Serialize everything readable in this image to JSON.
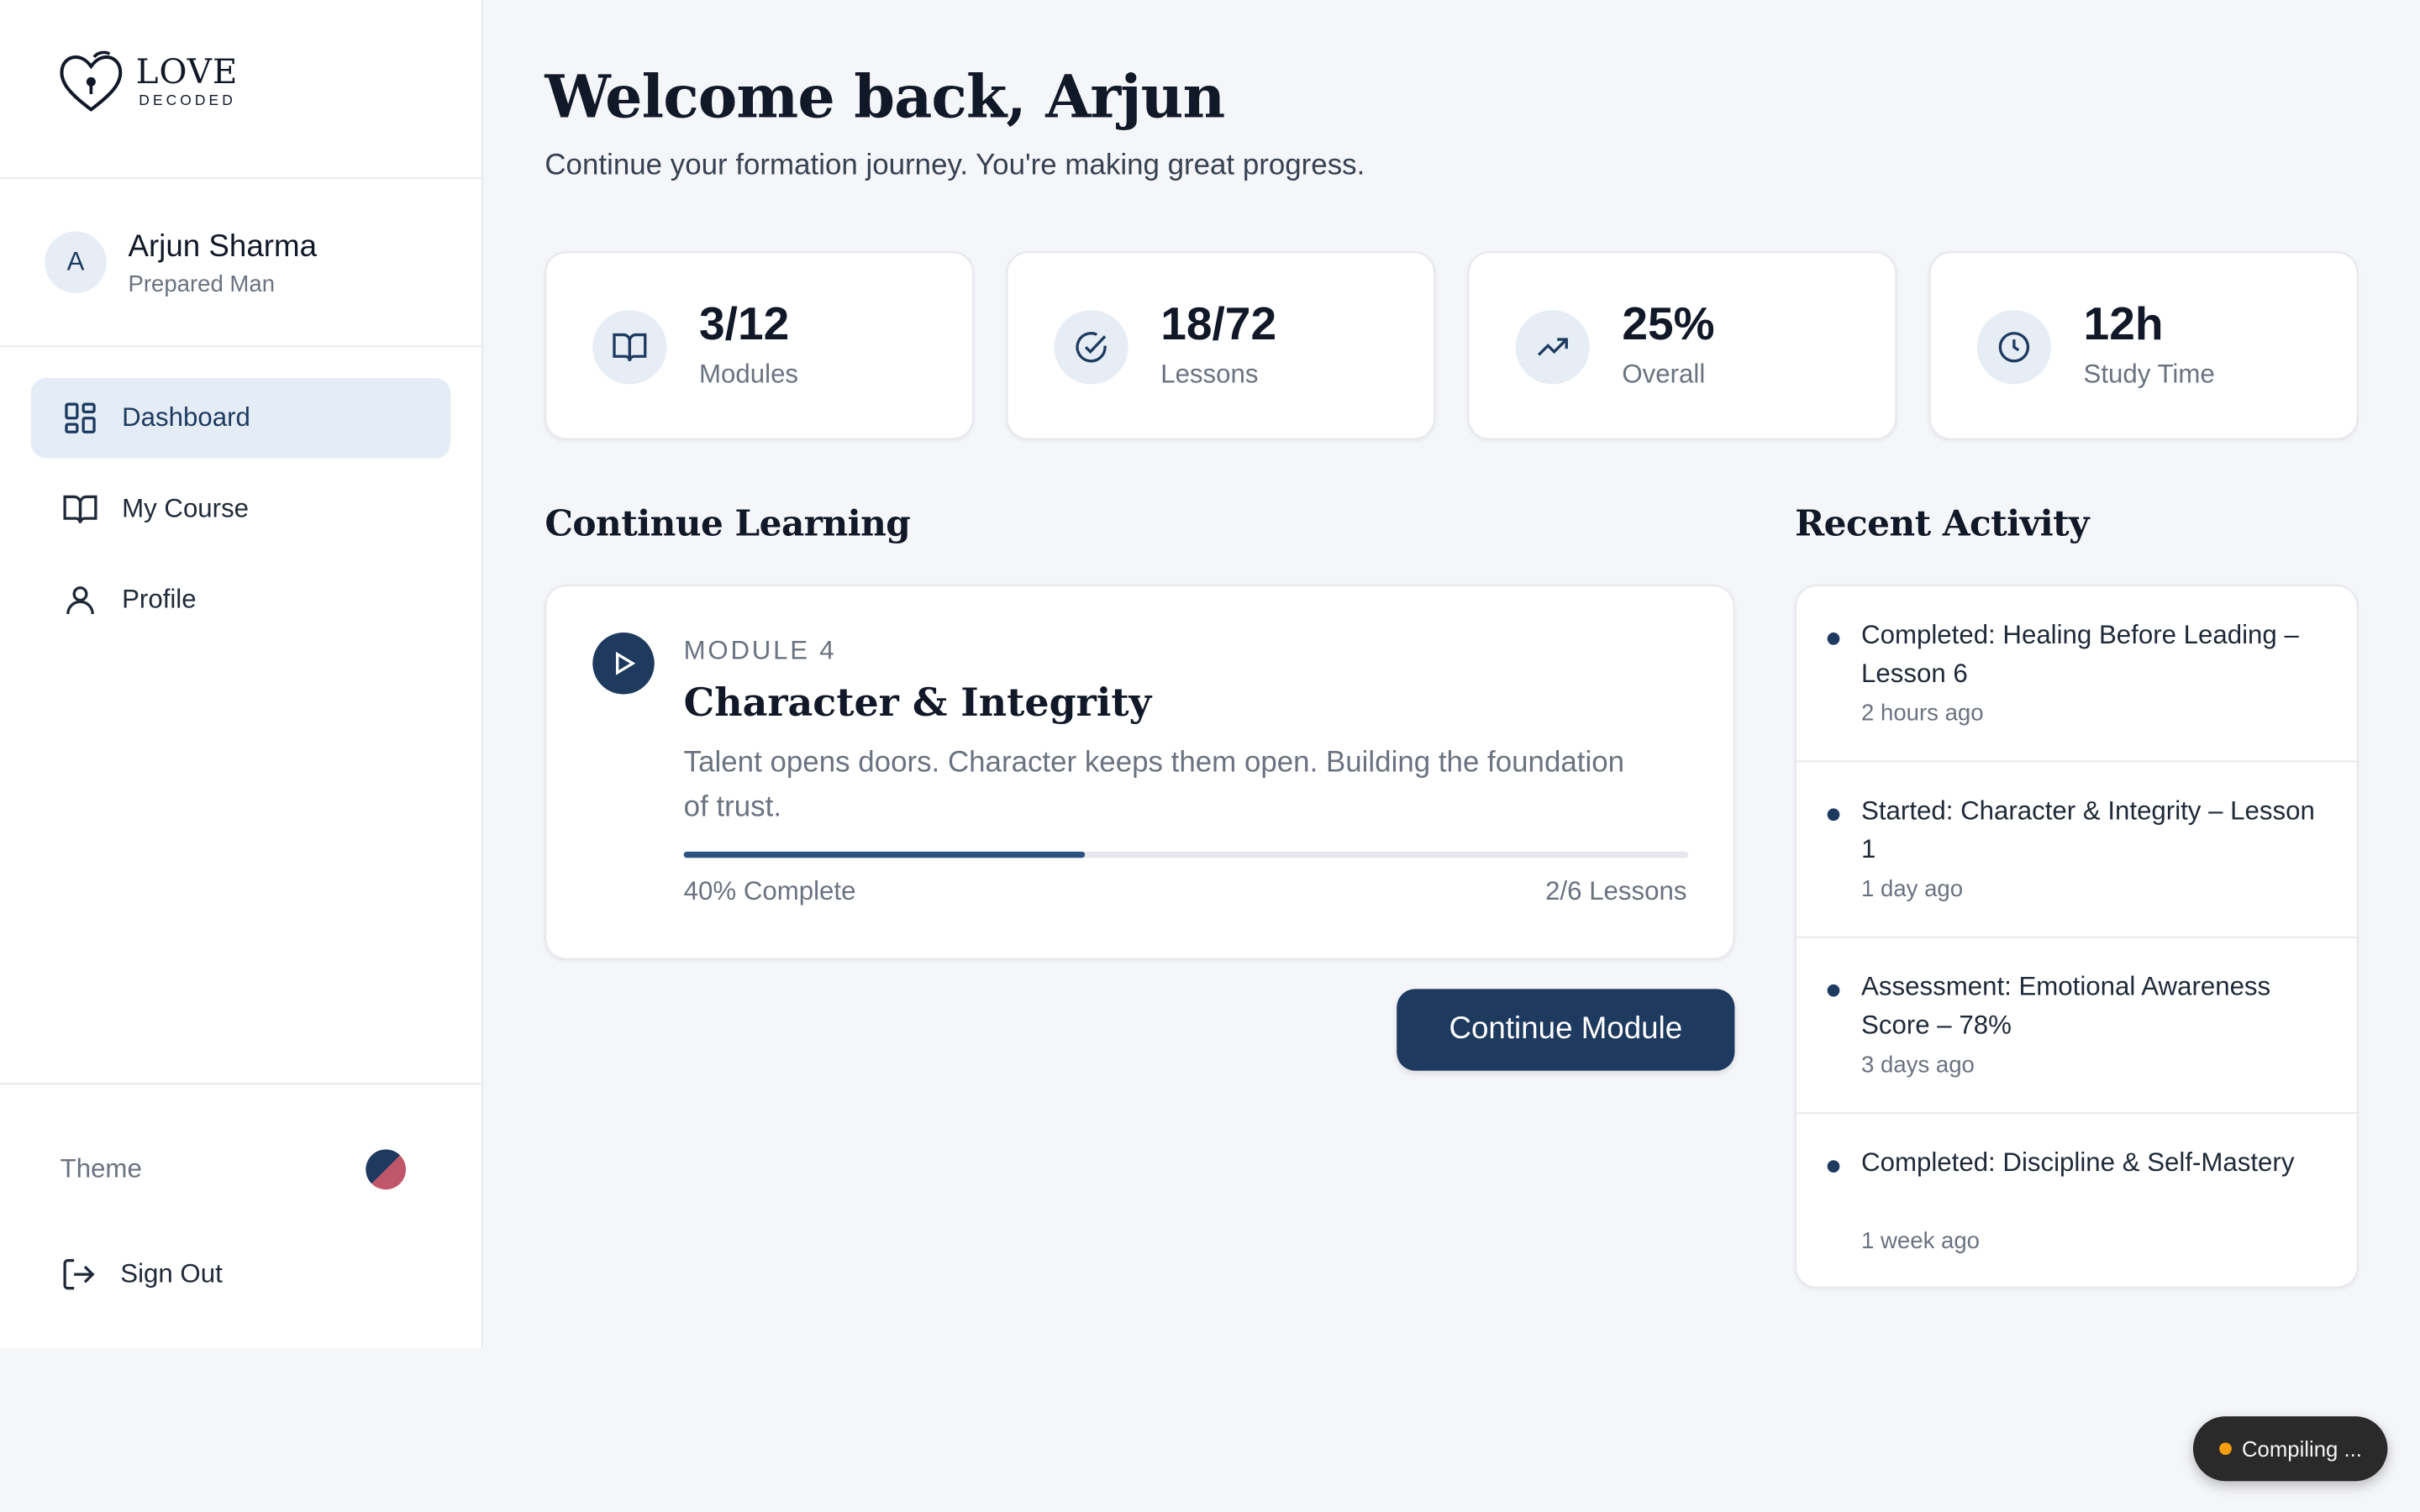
{
  "brand": {
    "word": "LOVE",
    "sub": "DECODED"
  },
  "user": {
    "initial": "A",
    "name": "Arjun Sharma",
    "role": "Prepared Man"
  },
  "nav": [
    {
      "label": "Dashboard",
      "icon": "dashboard-icon",
      "active": true
    },
    {
      "label": "My Course",
      "icon": "book-icon",
      "active": false
    },
    {
      "label": "Profile",
      "icon": "user-icon",
      "active": false
    }
  ],
  "sidebar_bottom": {
    "theme_label": "Theme",
    "signout_label": "Sign Out"
  },
  "header": {
    "welcome": "Welcome back, Arjun",
    "subtitle": "Continue your formation journey. You're making great progress."
  },
  "stats": [
    {
      "value": "3/12",
      "label": "Modules",
      "icon": "book-icon"
    },
    {
      "value": "18/72",
      "label": "Lessons",
      "icon": "check-circle-icon"
    },
    {
      "value": "25%",
      "label": "Overall",
      "icon": "trending-up-icon"
    },
    {
      "value": "12h",
      "label": "Study Time",
      "icon": "clock-icon"
    }
  ],
  "continue_learning": {
    "section_title": "Continue Learning",
    "kicker": "MODULE 4",
    "title": "Character & Integrity",
    "description": "Talent opens doors. Character keeps them open. Building the foundation of trust.",
    "progress_percent": 40,
    "progress_label": "40% Complete",
    "lessons_label": "2/6 Lessons",
    "button_label": "Continue Module"
  },
  "recent_activity": {
    "section_title": "Recent Activity",
    "items": [
      {
        "text": "Completed: Healing Before Leading – Lesson 6",
        "time": "2 hours ago"
      },
      {
        "text": "Started: Character & Integrity – Lesson 1",
        "time": "1 day ago"
      },
      {
        "text": "Assessment: Emotional Awareness Score – 78%",
        "time": "3 days ago"
      },
      {
        "text": "Completed: Discipline & Self-Mastery",
        "time": "1 week ago"
      }
    ]
  },
  "status_pill": {
    "label": "Compiling ..."
  },
  "colors": {
    "primary": "#1e3a5f",
    "accent": "#c0566a",
    "background": "#f5f6f9",
    "status_dot": "#f59e0b"
  }
}
